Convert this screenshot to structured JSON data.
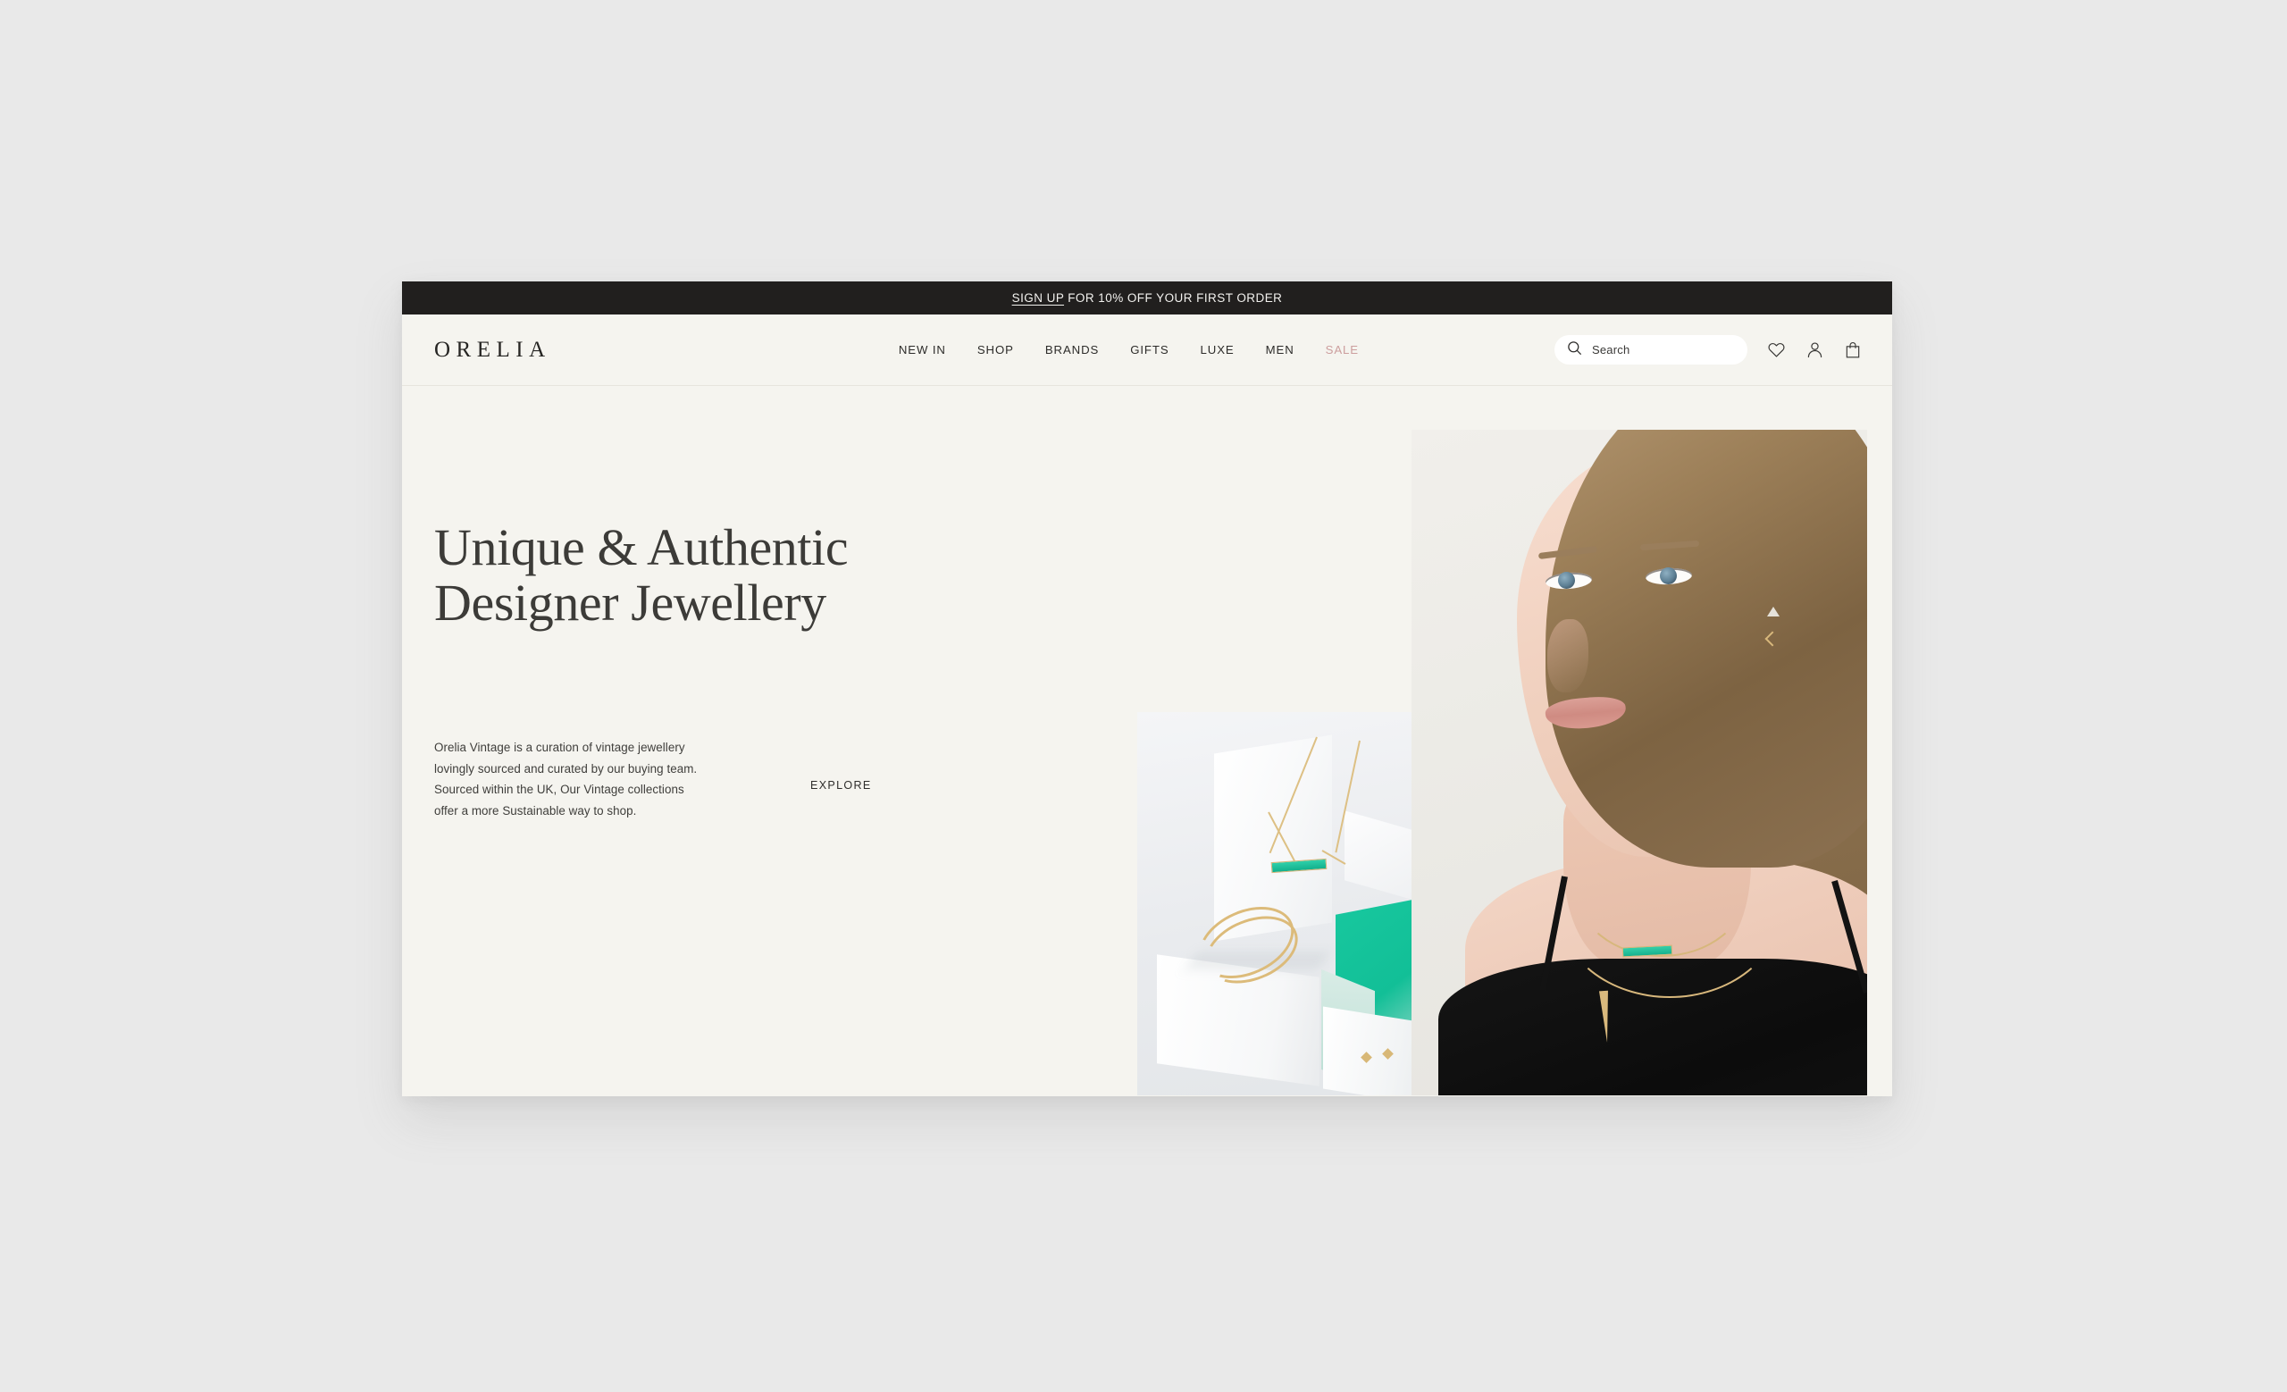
{
  "announcement": {
    "link_label": "SIGN UP",
    "rest_text": " FOR 10% OFF YOUR FIRST ORDER",
    "background": "#211f1e",
    "text_color": "#f2f1ee"
  },
  "header": {
    "logo": "ORELIA",
    "nav": [
      {
        "label": "NEW IN",
        "name": "new-in",
        "sale": false
      },
      {
        "label": "SHOP",
        "name": "shop",
        "sale": false
      },
      {
        "label": "BRANDS",
        "name": "brands",
        "sale": false
      },
      {
        "label": "GIFTS",
        "name": "gifts",
        "sale": false
      },
      {
        "label": "LUXE",
        "name": "luxe",
        "sale": false
      },
      {
        "label": "MEN",
        "name": "men",
        "sale": false
      },
      {
        "label": "SALE",
        "name": "sale",
        "sale": true
      }
    ],
    "search": {
      "placeholder": "Search",
      "value": ""
    },
    "icons": [
      "heart-icon",
      "account-icon",
      "shopping-bag-icon"
    ],
    "sale_color": "#cc9e9e",
    "background": "#f5f4ef"
  },
  "hero": {
    "headline_line1": "Unique & Authentic",
    "headline_line2": "Designer Jewellery",
    "body": "Orelia Vintage is a curation of vintage jewellery lovingly sourced and curated by our buying team. Sourced within the UK, Our Vintage collections offer a more Sustainable way to shop.",
    "explore_label": "EXPLORE",
    "background": "#f5f4ef",
    "headline_color": "#3c3b38",
    "accent_teal": "#17c79e",
    "accent_gold": "#d7b77c"
  }
}
